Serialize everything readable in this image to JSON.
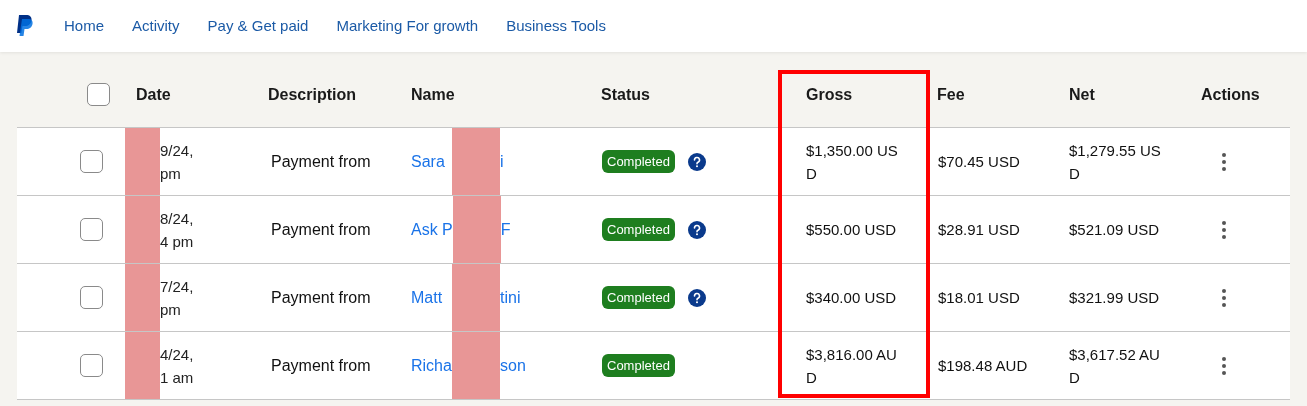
{
  "nav": {
    "items": [
      "Home",
      "Activity",
      "Pay & Get paid",
      "Marketing For growth",
      "Business Tools"
    ]
  },
  "table": {
    "select_all": {
      "checked": false
    },
    "columns": [
      {
        "label": "Date",
        "highlighted": false
      },
      {
        "label": "Description",
        "highlighted": false
      },
      {
        "label": "Name",
        "highlighted": false
      },
      {
        "label": "Status",
        "highlighted": false
      },
      {
        "label": "Gross",
        "highlighted": true
      },
      {
        "label": "Fee",
        "highlighted": false
      },
      {
        "label": "Net",
        "highlighted": false
      },
      {
        "label": "Actions",
        "highlighted": false
      }
    ],
    "rows": [
      {
        "checked": false,
        "date": [
          "9/24,",
          "pm"
        ],
        "description": "Payment from",
        "name": [
          "Sara",
          "i"
        ],
        "status": "Completed",
        "help": true,
        "gross": [
          "$1,350.00 US",
          "D"
        ],
        "fee": [
          "$70.45 USD"
        ],
        "net": [
          "$1,279.55 US",
          "D"
        ]
      },
      {
        "checked": false,
        "date": [
          "8/24,",
          "4 pm"
        ],
        "description": "Payment from",
        "name": [
          "Ask P",
          "F"
        ],
        "status": "Completed",
        "help": true,
        "gross": [
          "$550.00 USD"
        ],
        "fee": [
          "$28.91 USD"
        ],
        "net": [
          "$521.09 USD"
        ]
      },
      {
        "checked": false,
        "date": [
          "7/24,",
          "pm"
        ],
        "description": "Payment from",
        "name": [
          "Matt",
          "tini"
        ],
        "status": "Completed",
        "help": true,
        "gross": [
          "$340.00 USD"
        ],
        "fee": [
          "$18.01 USD"
        ],
        "net": [
          "$321.99 USD"
        ]
      },
      {
        "checked": false,
        "date": [
          "4/24,",
          "1 am"
        ],
        "description": "Payment from",
        "name": [
          "Richa",
          "son"
        ],
        "status": "Completed",
        "help": false,
        "gross": [
          "$3,816.00 AU",
          "D"
        ],
        "fee": [
          "$198.48 AUD"
        ],
        "net": [
          "$3,617.52 AU",
          "D"
        ]
      }
    ]
  }
}
